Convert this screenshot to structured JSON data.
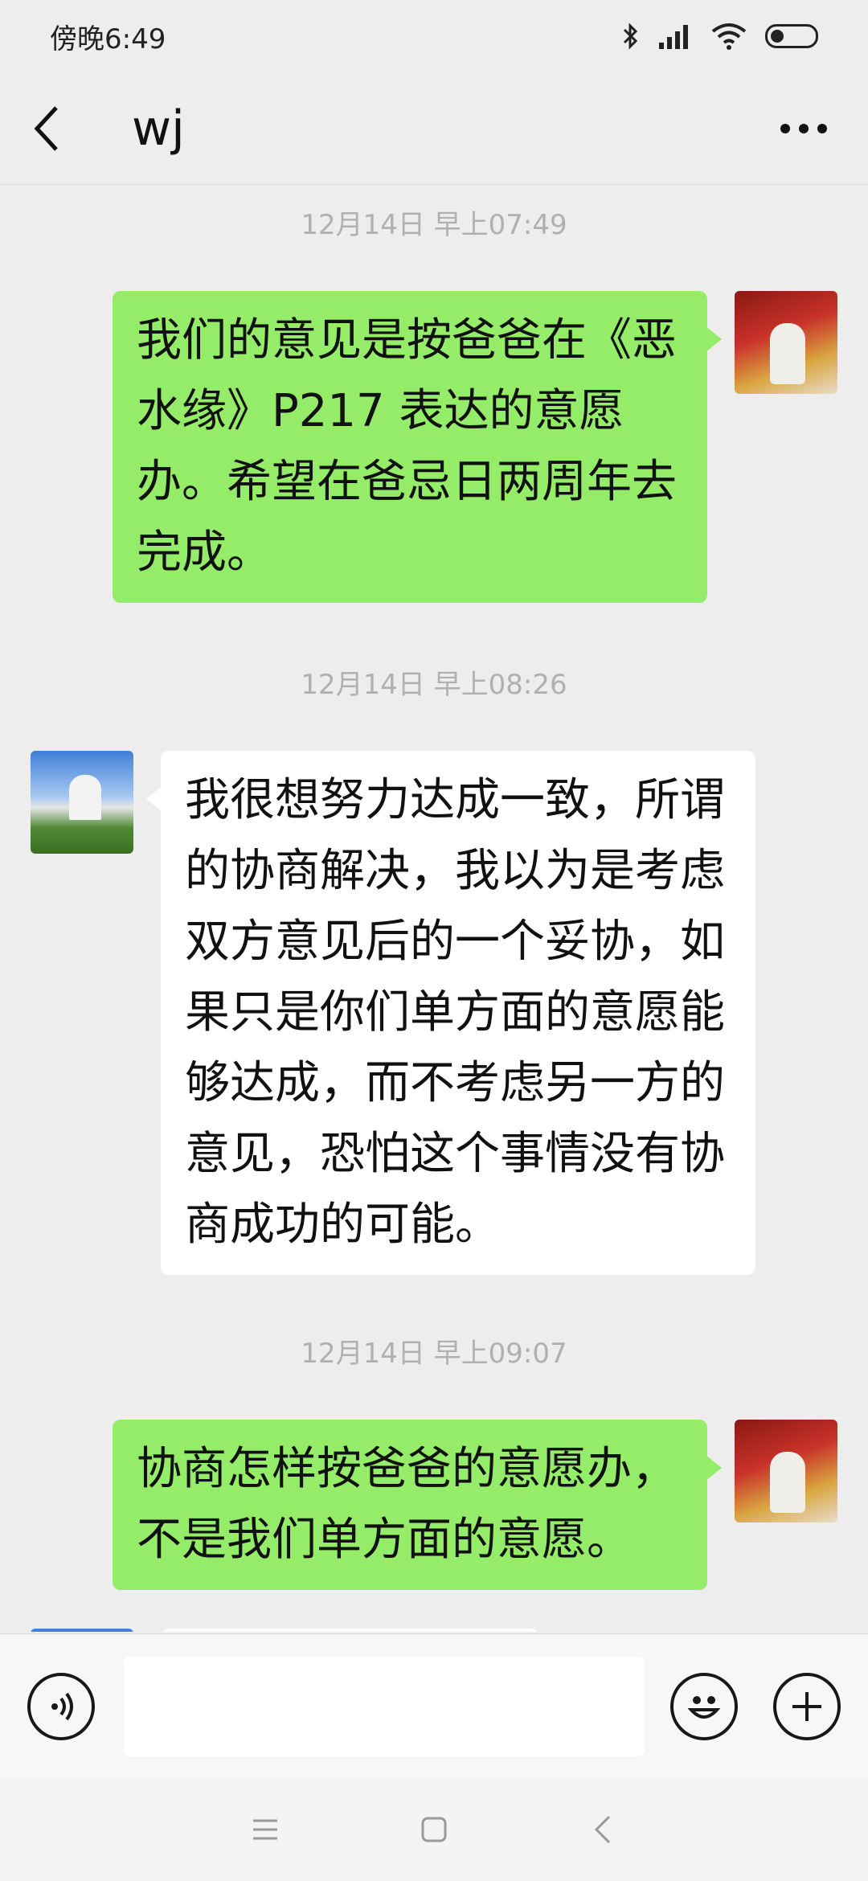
{
  "status_bar": {
    "time": "傍晚6:49",
    "icons": [
      "bluetooth-icon",
      "signal-icon",
      "wifi-icon",
      "battery-icon"
    ]
  },
  "header": {
    "title": "wj",
    "back_icon": "chevron-left-icon",
    "more_icon": "more-dots-icon",
    "more_label": "⋯"
  },
  "messages": [
    {
      "type": "timestamp",
      "text": "12月14日 早上07:49"
    },
    {
      "type": "self",
      "text": "我们的意见是按爸爸在《恶水缘》P217 表达的意愿办。希望在爸忌日两周年去完成。"
    },
    {
      "type": "timestamp",
      "text": "12月14日 早上08:26"
    },
    {
      "type": "other",
      "text": "我很想努力达成一致，所谓的协商解决，我以为是考虑双方意见后的一个妥协，如果只是你们单方面的意愿能够达成，而不考虑另一方的意见，恐怕这个事情没有协商成功的可能。"
    },
    {
      "type": "timestamp",
      "text": "12月14日 早上09:07"
    },
    {
      "type": "self",
      "text": "协商怎样按爸爸的意愿办，不是我们单方面的意愿。"
    }
  ],
  "input_bar": {
    "voice_icon": "voice-icon",
    "emoji_icon": "emoji-icon",
    "plus_icon": "plus-icon",
    "input_value": "",
    "input_placeholder": ""
  },
  "nav_bar": {
    "icons": [
      "menu-icon",
      "home-icon",
      "back-icon"
    ]
  },
  "colors": {
    "self_bubble": "#95ec69",
    "other_bubble": "#ffffff",
    "background": "#ededed"
  }
}
